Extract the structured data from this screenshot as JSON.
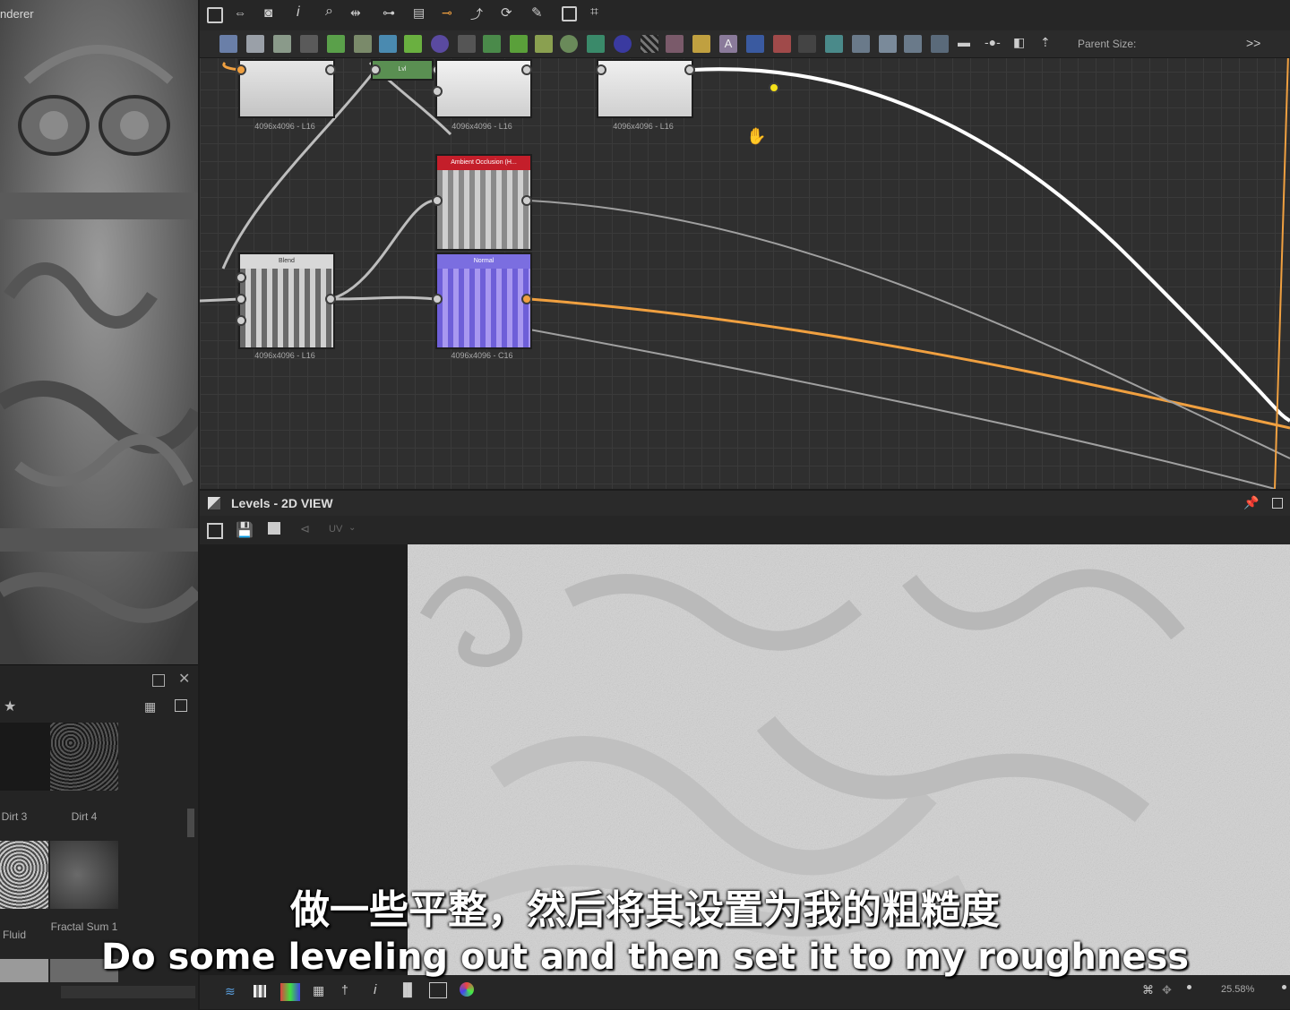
{
  "left_panel": {
    "title": "nderer"
  },
  "library": {
    "items": [
      {
        "label": "Dirt 3"
      },
      {
        "label": "Dirt 4"
      },
      {
        "label": "Fluid"
      },
      {
        "label": "Fractal Sum 1"
      }
    ]
  },
  "graph_toolbar": {
    "parent_size_label": "Parent Size:",
    "more_label": ">>"
  },
  "graph": {
    "nodes": [
      {
        "title": "",
        "size_label": "4096x4096 - L16"
      },
      {
        "title": "Lvl",
        "size_label": ""
      },
      {
        "title": "",
        "size_label": "4096x4096 - L16"
      },
      {
        "title": "",
        "size_label": "4096x4096 - L16"
      },
      {
        "title": "Ambient Occlusion (H...",
        "size_label": ""
      },
      {
        "title": "Blend",
        "size_label": "4096x4096 - L16"
      },
      {
        "title": "Normal",
        "size_label": "4096x4096 - C16"
      }
    ]
  },
  "view_2d": {
    "title": "Levels - 2D VIEW",
    "uv_label": "UV",
    "zoom": "25.58%"
  },
  "subtitles": {
    "chinese": "做一些平整，然后将其设置为我的粗糙度",
    "english": "Do some leveling out and then set it to my roughness"
  },
  "colors": {
    "orange_link": "#f0a040",
    "white_link": "#ffffff",
    "selected_port": "#f5e11a",
    "normal_node": "#7b6ee0",
    "ao_header": "#c41e2a"
  }
}
